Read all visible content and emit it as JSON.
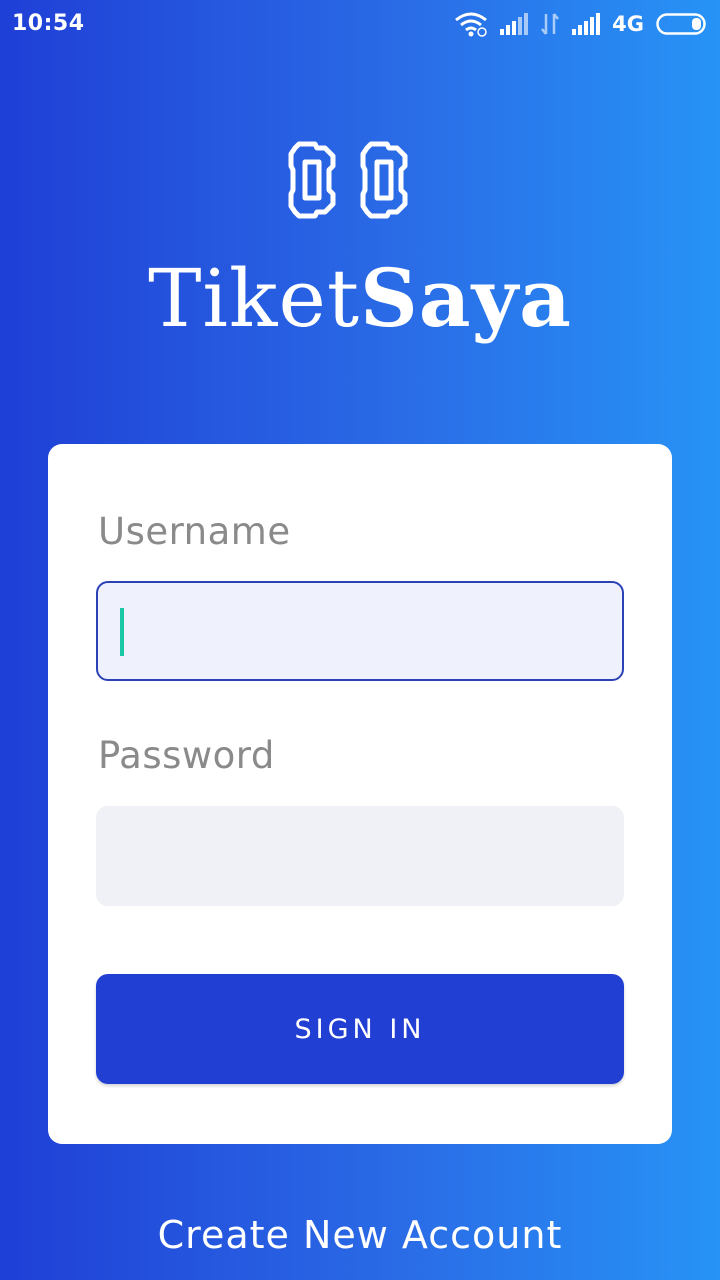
{
  "status_bar": {
    "time": "10:54",
    "network": "4G",
    "icons": [
      "wifi-icon",
      "signal-icon",
      "data-transfer-icon",
      "signal-icon",
      "battery-icon"
    ]
  },
  "brand": {
    "logo_icon": "ticket-pair-icon",
    "name_light": "Tiket",
    "name_bold": "Saya"
  },
  "login_form": {
    "username_label": "Username",
    "username_value": "",
    "password_label": "Password",
    "password_value": "",
    "signin_label": "SIGN IN"
  },
  "footer": {
    "create_account_label": "Create New Account"
  },
  "colors": {
    "gradient_start": "#1f3fd6",
    "gradient_end": "#2793f6",
    "button": "#213fd2",
    "caret": "#1cc7a6",
    "label": "#8a8a8a"
  }
}
